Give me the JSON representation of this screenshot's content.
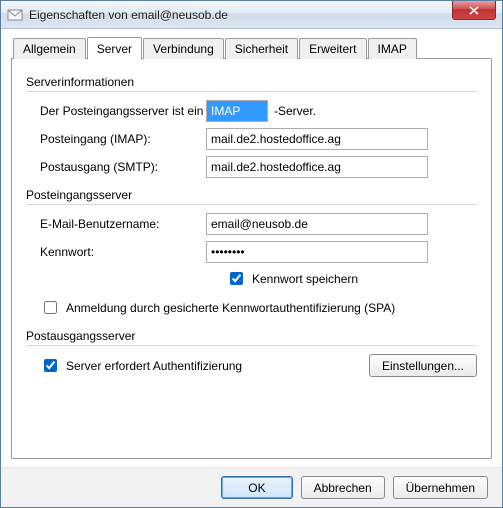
{
  "window": {
    "title": "Eigenschaften von email@neusob.de"
  },
  "tabs": {
    "general": "Allgemein",
    "server": "Server",
    "connection": "Verbindung",
    "security": "Sicherheit",
    "advanced": "Erweitert",
    "imap": "IMAP",
    "active": "server"
  },
  "groups": {
    "server_info": "Serverinformationen",
    "incoming": "Posteingangsserver",
    "outgoing": "Postausgangsserver"
  },
  "fields": {
    "incoming_type_prefix": "Der Posteingangsserver ist ein",
    "incoming_type_value": "IMAP",
    "incoming_type_suffix": "-Server.",
    "incoming_label": "Posteingang (IMAP):",
    "incoming_value": "mail.de2.hostedoffice.ag",
    "outgoing_label": "Postausgang (SMTP):",
    "outgoing_value": "mail.de2.hostedoffice.ag",
    "username_label": "E-Mail-Benutzername:",
    "username_value": "email@neusob.de",
    "password_label": "Kennwort:",
    "password_value": "••••••••",
    "remember_label": "Kennwort speichern",
    "remember_checked": true,
    "spa_label": "Anmeldung durch gesicherte Kennwortauthentifizierung (SPA)",
    "spa_checked": false,
    "smtp_auth_label": "Server erfordert Authentifizierung",
    "smtp_auth_checked": true,
    "settings_button": "Einstellungen..."
  },
  "footer": {
    "ok": "OK",
    "cancel": "Abbrechen",
    "apply": "Übernehmen"
  }
}
